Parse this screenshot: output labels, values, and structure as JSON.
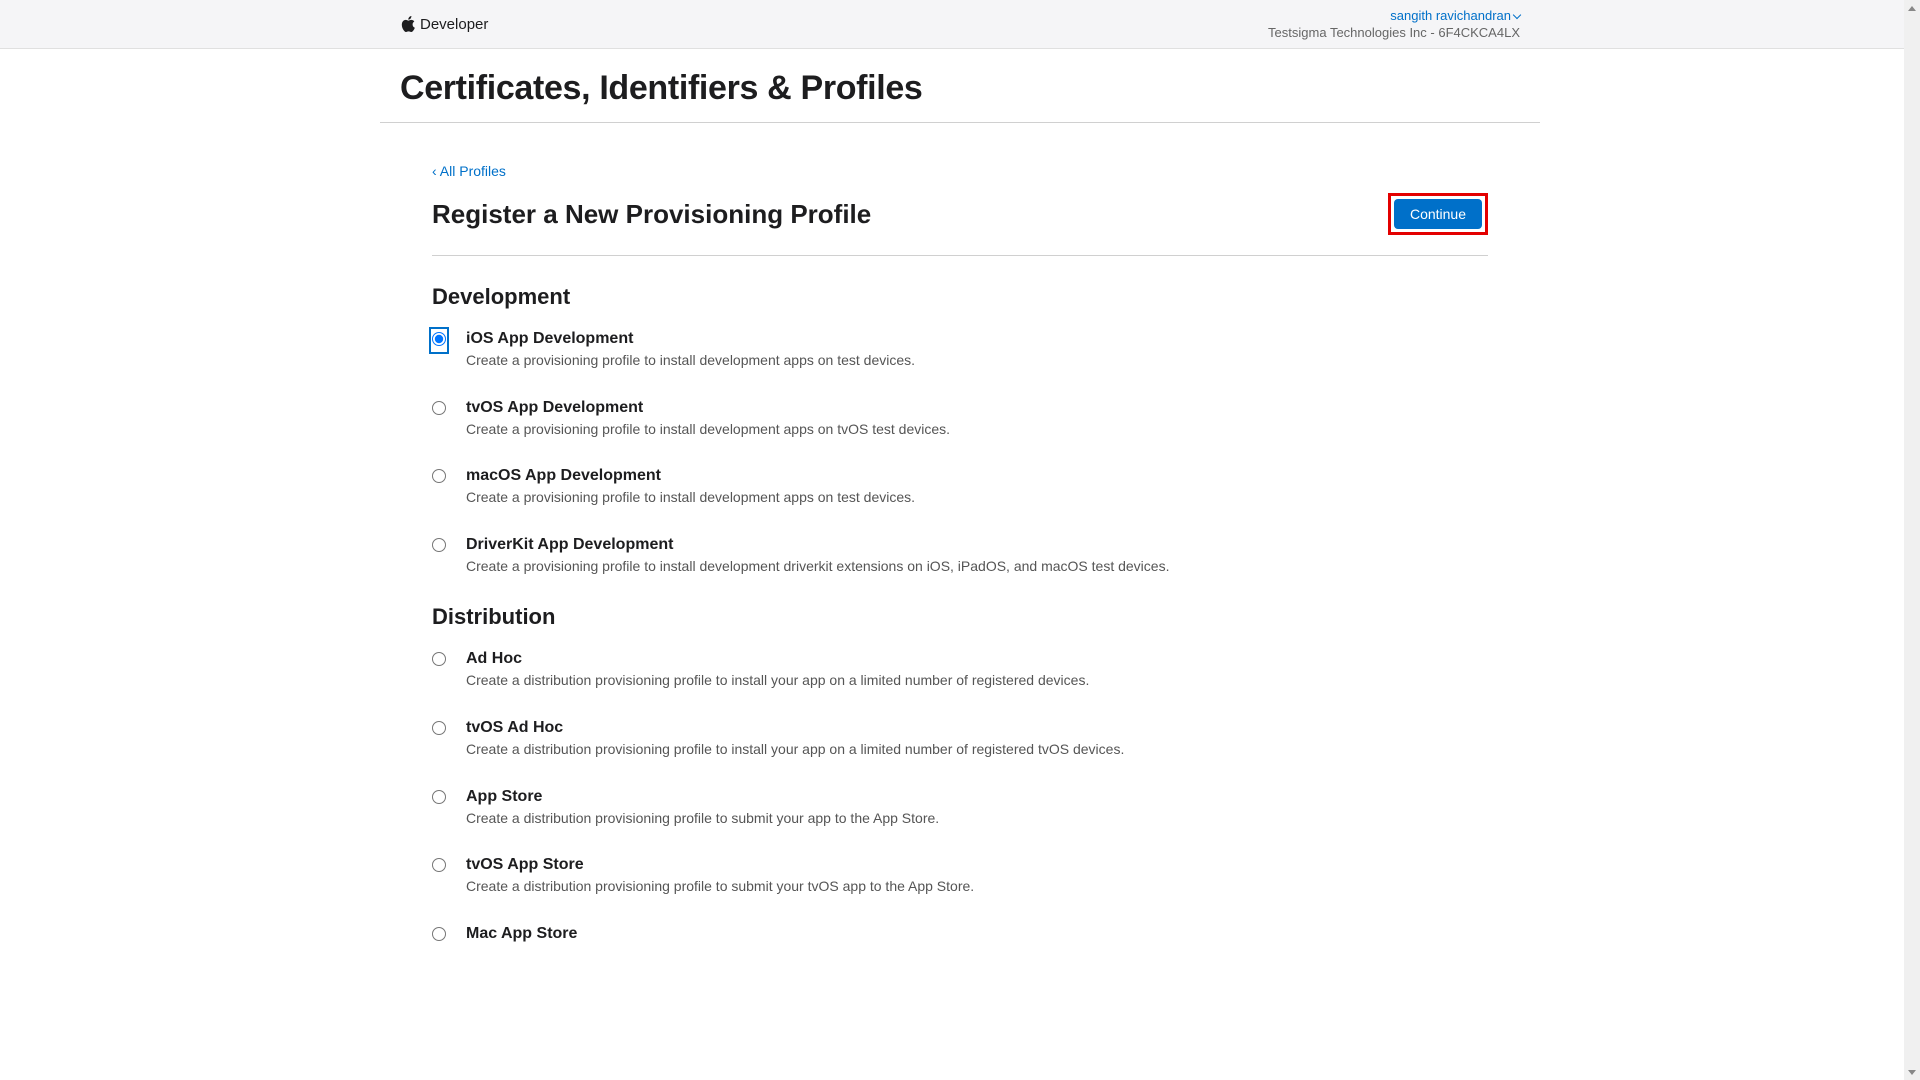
{
  "header": {
    "brand": "Developer",
    "user_name": "sangith ravichandran",
    "team_name": "Testsigma Technologies Inc - 6F4CKCA4LX"
  },
  "page_title": "Certificates, Identifiers & Profiles",
  "back_link": "‹ All Profiles",
  "subheader": "Register a New Provisioning Profile",
  "continue_label": "Continue",
  "sections": [
    {
      "title": "Development",
      "options": [
        {
          "id": "ios-dev",
          "selected": true,
          "title": "iOS App Development",
          "desc": "Create a provisioning profile to install development apps on test devices."
        },
        {
          "id": "tvos-dev",
          "selected": false,
          "title": "tvOS App Development",
          "desc": "Create a provisioning profile to install development apps on tvOS test devices."
        },
        {
          "id": "macos-dev",
          "selected": false,
          "title": "macOS App Development",
          "desc": "Create a provisioning profile to install development apps on test devices."
        },
        {
          "id": "driverkit-dev",
          "selected": false,
          "title": "DriverKit App Development",
          "desc": "Create a provisioning profile to install development driverkit extensions on iOS, iPadOS, and macOS test devices."
        }
      ]
    },
    {
      "title": "Distribution",
      "options": [
        {
          "id": "adhoc",
          "selected": false,
          "title": "Ad Hoc",
          "desc": "Create a distribution provisioning profile to install your app on a limited number of registered devices."
        },
        {
          "id": "tvos-adhoc",
          "selected": false,
          "title": "tvOS Ad Hoc",
          "desc": "Create a distribution provisioning profile to install your app on a limited number of registered tvOS devices."
        },
        {
          "id": "appstore",
          "selected": false,
          "title": "App Store",
          "desc": "Create a distribution provisioning profile to submit your app to the App Store."
        },
        {
          "id": "tvos-appstore",
          "selected": false,
          "title": "tvOS App Store",
          "desc": "Create a distribution provisioning profile to submit your tvOS app to the App Store."
        },
        {
          "id": "mac-appstore",
          "selected": false,
          "title": "Mac App Store",
          "desc": ""
        }
      ]
    }
  ]
}
